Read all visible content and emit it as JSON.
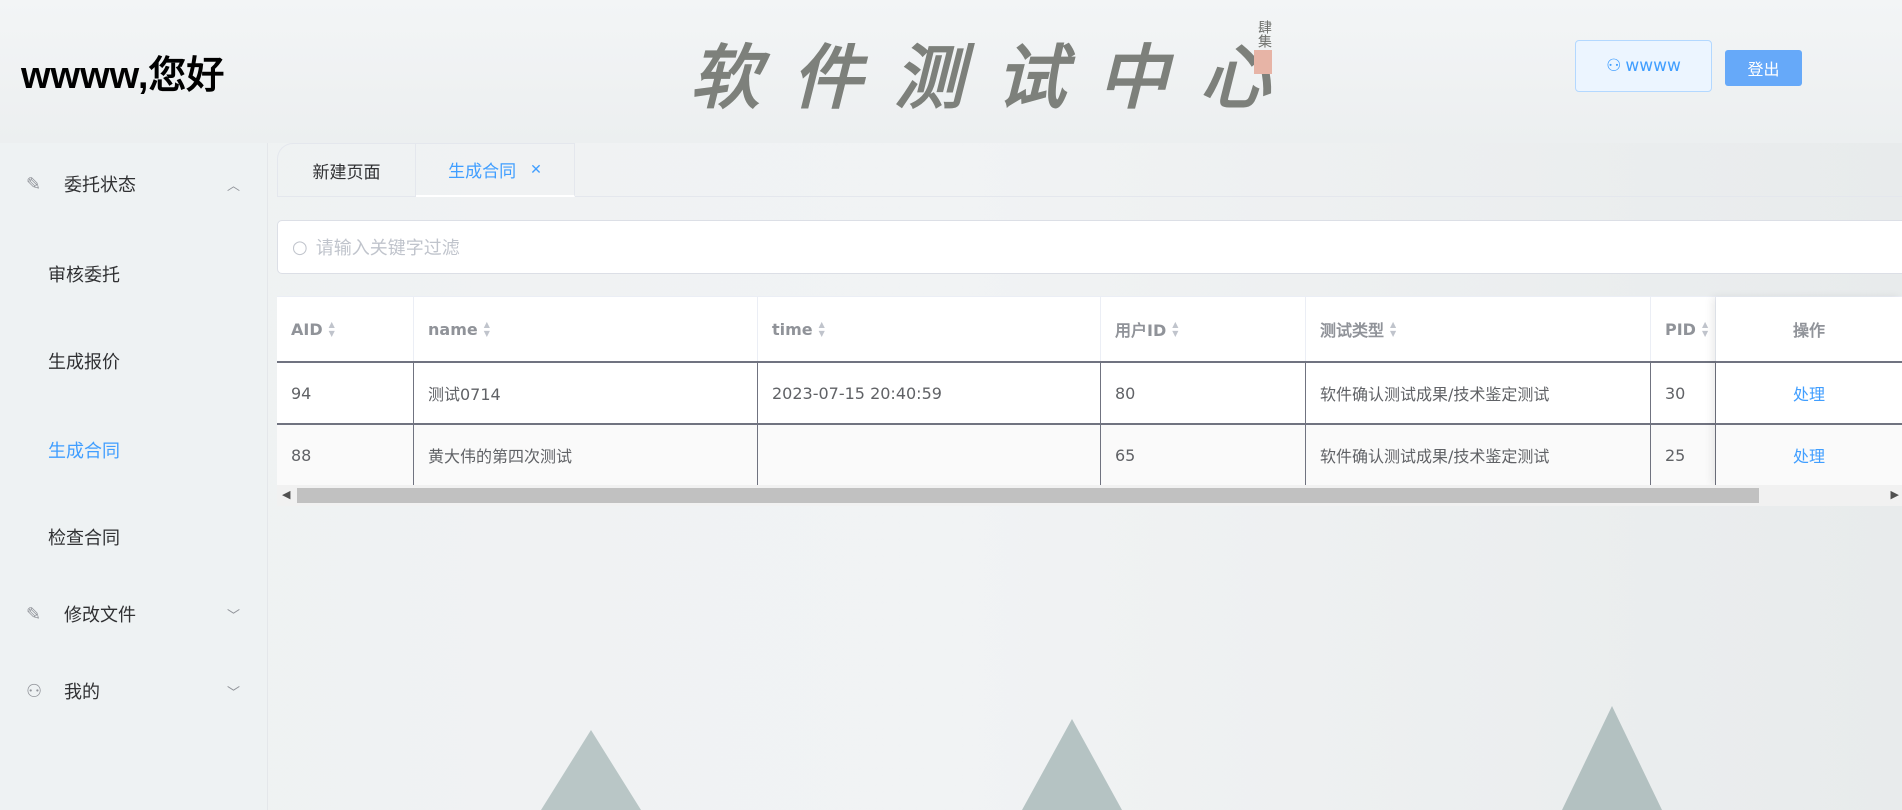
{
  "header": {
    "greeting": "wwww,您好",
    "logo_text": "软件测试中心",
    "seal_text": "肆集",
    "user_label": "wwww",
    "logout_label": "登出"
  },
  "sidebar": {
    "groups": [
      {
        "label": "委托状态",
        "icon": "pencil-icon",
        "expanded": true,
        "items": [
          {
            "label": "审核委托",
            "active": false
          },
          {
            "label": "生成报价",
            "active": false
          },
          {
            "label": "生成合同",
            "active": true
          },
          {
            "label": "检查合同",
            "active": false
          }
        ]
      },
      {
        "label": "修改文件",
        "icon": "pencil-icon",
        "expanded": false
      },
      {
        "label": "我的",
        "icon": "user-icon",
        "expanded": false
      }
    ]
  },
  "tabs": [
    {
      "label": "新建页面",
      "active": false
    },
    {
      "label": "生成合同",
      "active": true,
      "closable": true
    }
  ],
  "search": {
    "placeholder": "请输入关键字过滤",
    "value": ""
  },
  "table": {
    "columns": [
      "AID",
      "name",
      "time",
      "用户ID",
      "测试类型",
      "PID",
      "操作"
    ],
    "rows": [
      {
        "AID": "94",
        "name": "测试0714",
        "time": "2023-07-15 20:40:59",
        "user_id": "80",
        "test_type": "软件确认测试成果/技术鉴定测试",
        "PID": "30",
        "action": "处理"
      },
      {
        "AID": "88",
        "name": "黄大伟的第四次测试",
        "time": "",
        "user_id": "65",
        "test_type": "软件确认测试成果/技术鉴定测试",
        "PID": "25",
        "action": "处理"
      }
    ]
  },
  "colors": {
    "accent": "#409eff",
    "logout_bg": "#66a9f9"
  }
}
